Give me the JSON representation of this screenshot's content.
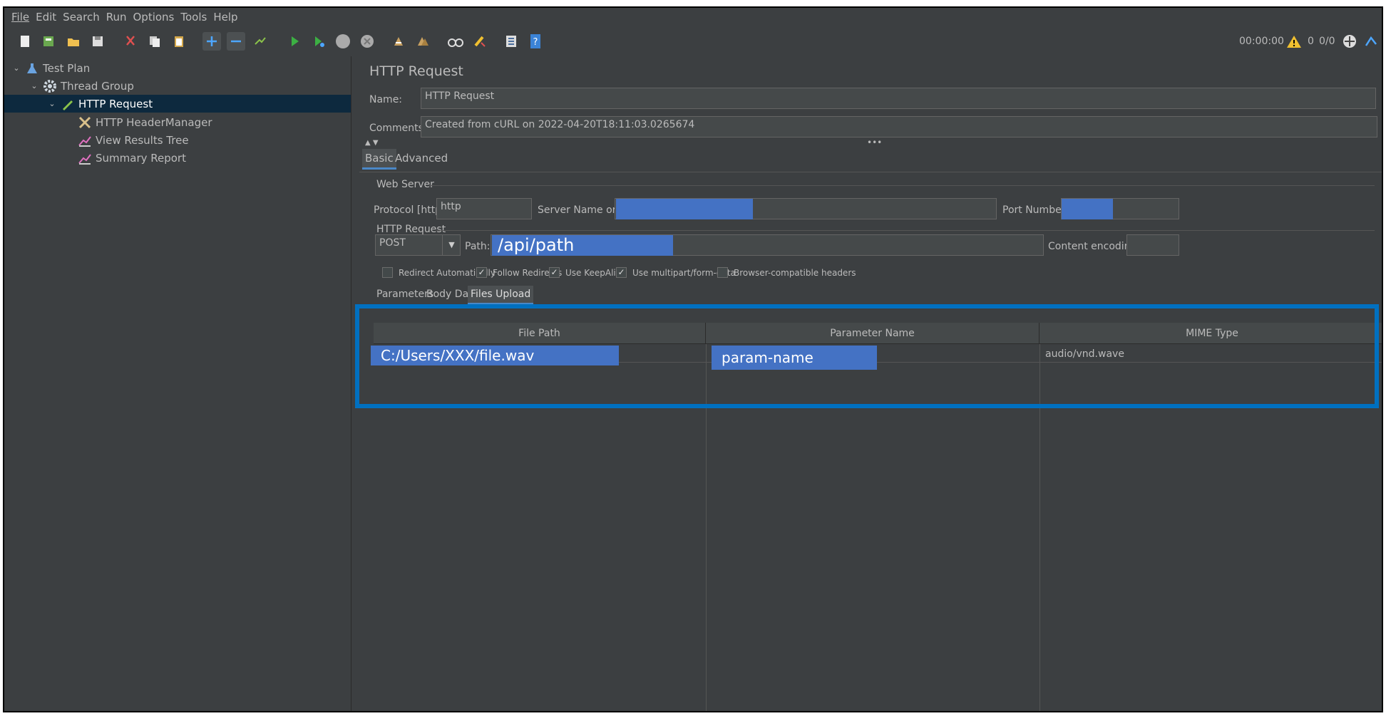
{
  "menu": [
    "File",
    "Edit",
    "Search",
    "Run",
    "Options",
    "Tools",
    "Help"
  ],
  "toolbar": {
    "timer": "00:00:00",
    "warning_count": "0",
    "threads": "0/0"
  },
  "tree": {
    "items": [
      {
        "label": "Test Plan",
        "icon": "flask-icon"
      },
      {
        "label": "Thread Group",
        "icon": "gear-icon"
      },
      {
        "label": "HTTP Request",
        "icon": "pencil-icon"
      },
      {
        "label": "HTTP HeaderManager",
        "icon": "tools-icon"
      },
      {
        "label": "View Results Tree",
        "icon": "chart-icon"
      },
      {
        "label": "Summary Report",
        "icon": "chart-icon"
      }
    ]
  },
  "panel": {
    "title": "HTTP Request",
    "name_label": "Name:",
    "name_value": "HTTP Request",
    "comments_label": "Comments:",
    "comments_value": "Created from cURL on 2022-04-20T18:11:03.0265674",
    "tabs": [
      "Basic",
      "Advanced"
    ],
    "web_server": {
      "group_label": "Web Server",
      "protocol_label": "Protocol [http]:",
      "protocol_value": "http",
      "server_label": "Server Name or IP:",
      "port_label": "Port Number:"
    },
    "http_request": {
      "group_label": "HTTP Request",
      "method": "POST",
      "path_label": "Path:",
      "path_value": "/api/path",
      "encoding_label": "Content encoding:"
    },
    "checkboxes": [
      {
        "label": "Redirect Automatically",
        "checked": false
      },
      {
        "label": "Follow Redirects",
        "checked": true
      },
      {
        "label": "Use KeepAlive",
        "checked": true
      },
      {
        "label": "Use multipart/form-data",
        "checked": true
      },
      {
        "label": "Browser-compatible headers",
        "checked": false
      }
    ],
    "sub_tabs": [
      "Parameters",
      "Body Data",
      "Files Upload"
    ],
    "files_table": {
      "columns": [
        "File Path",
        "Parameter Name",
        "MIME Type"
      ],
      "rows": [
        {
          "file_path": "C:/Users/XXX/file.wav",
          "param": "param-name",
          "mime": "audio/vnd.wave"
        }
      ]
    }
  },
  "colors": {
    "background": "#3c3f41",
    "selection": "#0d293e",
    "highlight": "#4472c4",
    "frame": "#0070c0"
  }
}
